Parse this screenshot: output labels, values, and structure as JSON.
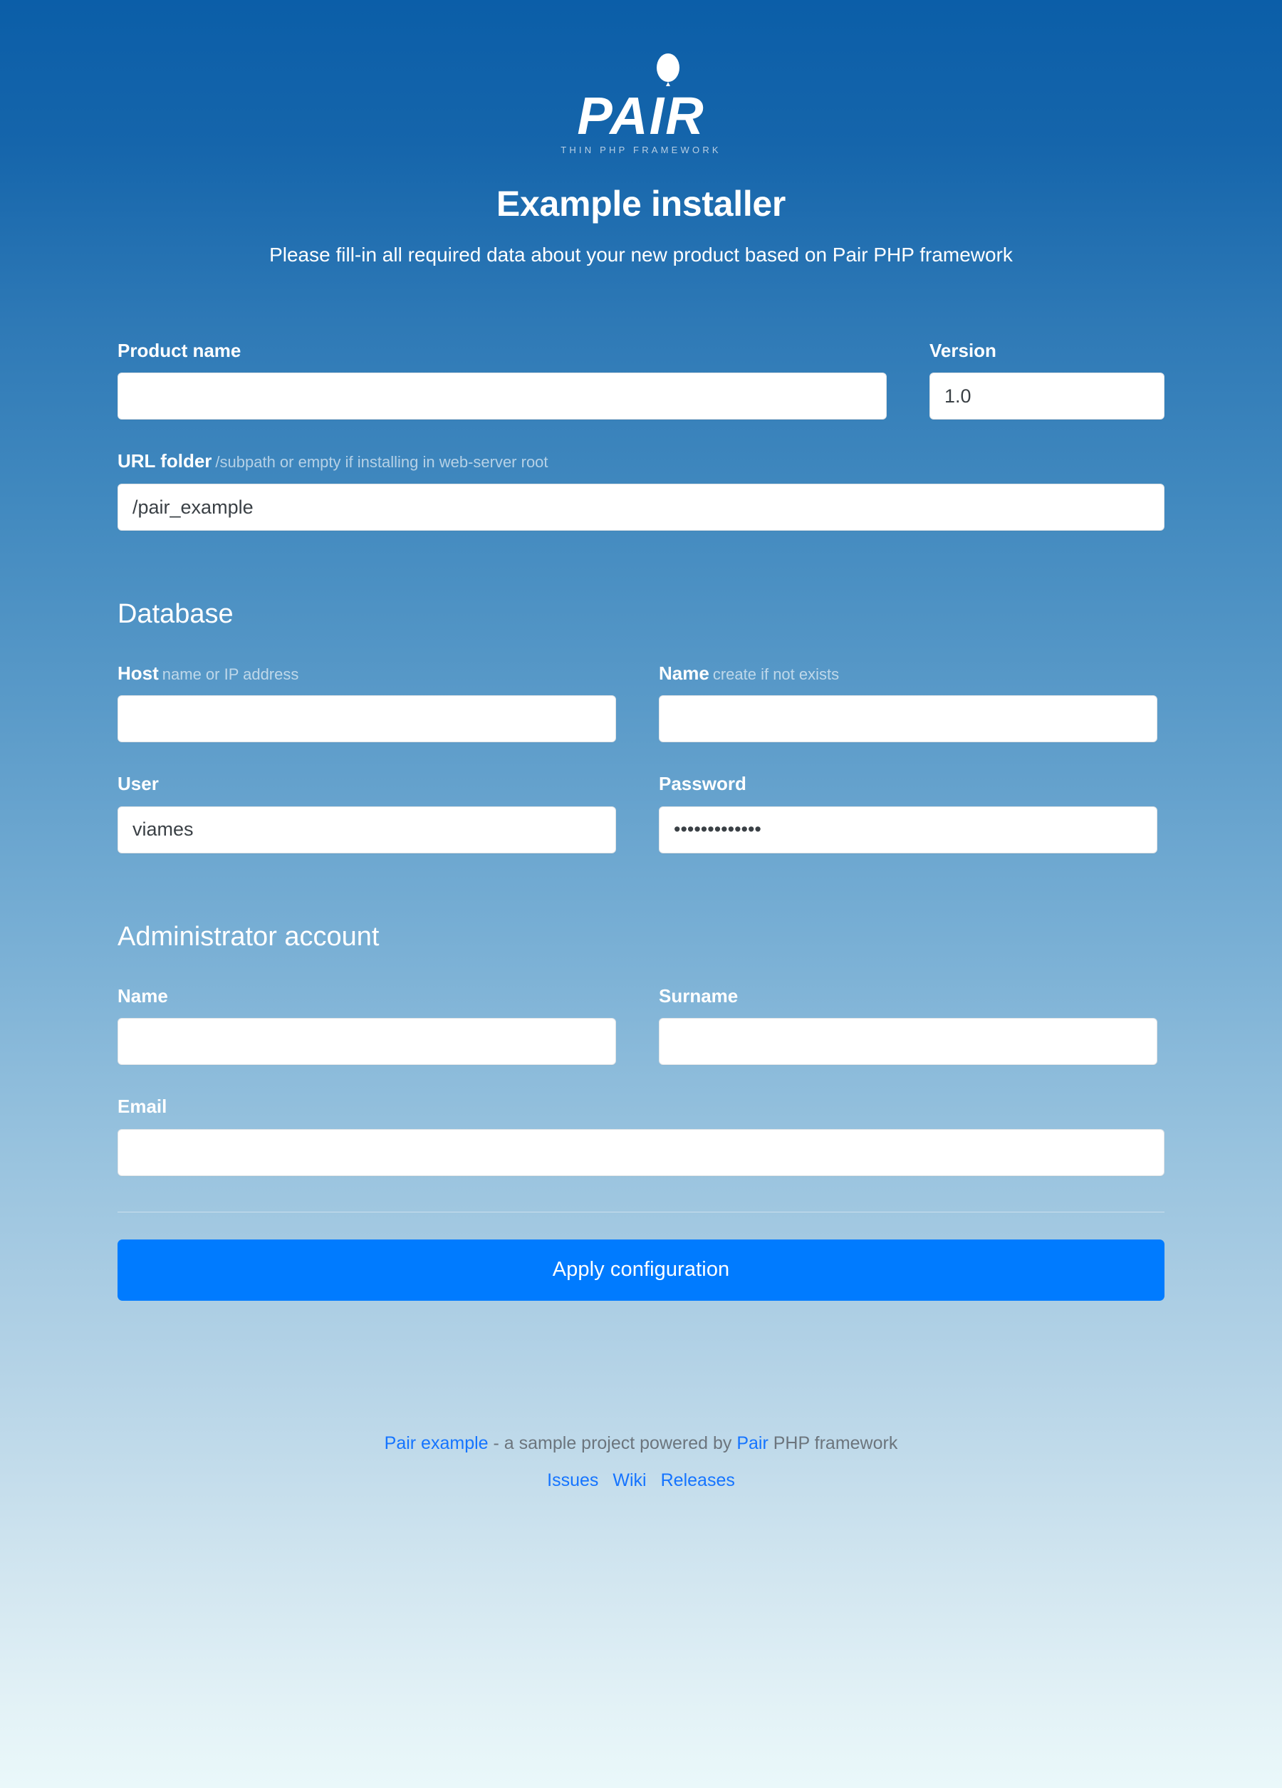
{
  "header": {
    "logo": {
      "wordmark": "PAIR",
      "tagline": "THIN PHP FRAMEWORK",
      "balloon_icon": "balloon-icon"
    },
    "title": "Example installer",
    "subtitle": "Please fill-in all required data about your new product based on Pair PHP framework"
  },
  "form": {
    "product_name": {
      "label": "Product name",
      "value": "",
      "placeholder": ""
    },
    "version": {
      "label": "Version",
      "value": "1.0",
      "placeholder": ""
    },
    "url_folder": {
      "label": "URL folder",
      "hint": "/subpath or empty if installing in web-server root",
      "value": "/pair_example",
      "placeholder": ""
    },
    "database": {
      "section_title": "Database",
      "host": {
        "label": "Host",
        "hint": "name or IP address",
        "value": "",
        "placeholder": ""
      },
      "name": {
        "label": "Name",
        "hint": "create if not exists",
        "value": "",
        "placeholder": ""
      },
      "user": {
        "label": "User",
        "value": "viames",
        "placeholder": ""
      },
      "password": {
        "label": "Password",
        "value": "•••••••••••••",
        "masked_char_count": 13,
        "placeholder": ""
      }
    },
    "administrator": {
      "section_title": "Administrator account",
      "name": {
        "label": "Name",
        "value": "",
        "placeholder": ""
      },
      "surname": {
        "label": "Surname",
        "value": "",
        "placeholder": ""
      },
      "email": {
        "label": "Email",
        "value": "",
        "placeholder": ""
      }
    },
    "submit": {
      "label": "Apply configuration"
    }
  },
  "footer": {
    "project_link": "Pair example",
    "text_middle": " - a sample project powered by ",
    "framework_link": "Pair",
    "text_end": " PHP framework",
    "links": [
      {
        "label": "Issues"
      },
      {
        "label": "Wiki"
      },
      {
        "label": "Releases"
      }
    ]
  },
  "colors": {
    "gradient_top": "#0b5ea8",
    "gradient_bottom": "#eaf8fa",
    "accent_button": "#007bff",
    "link": "#1574ff",
    "footer_text": "#6c757d",
    "input_background": "#ffffff",
    "label_text": "#ffffff"
  }
}
